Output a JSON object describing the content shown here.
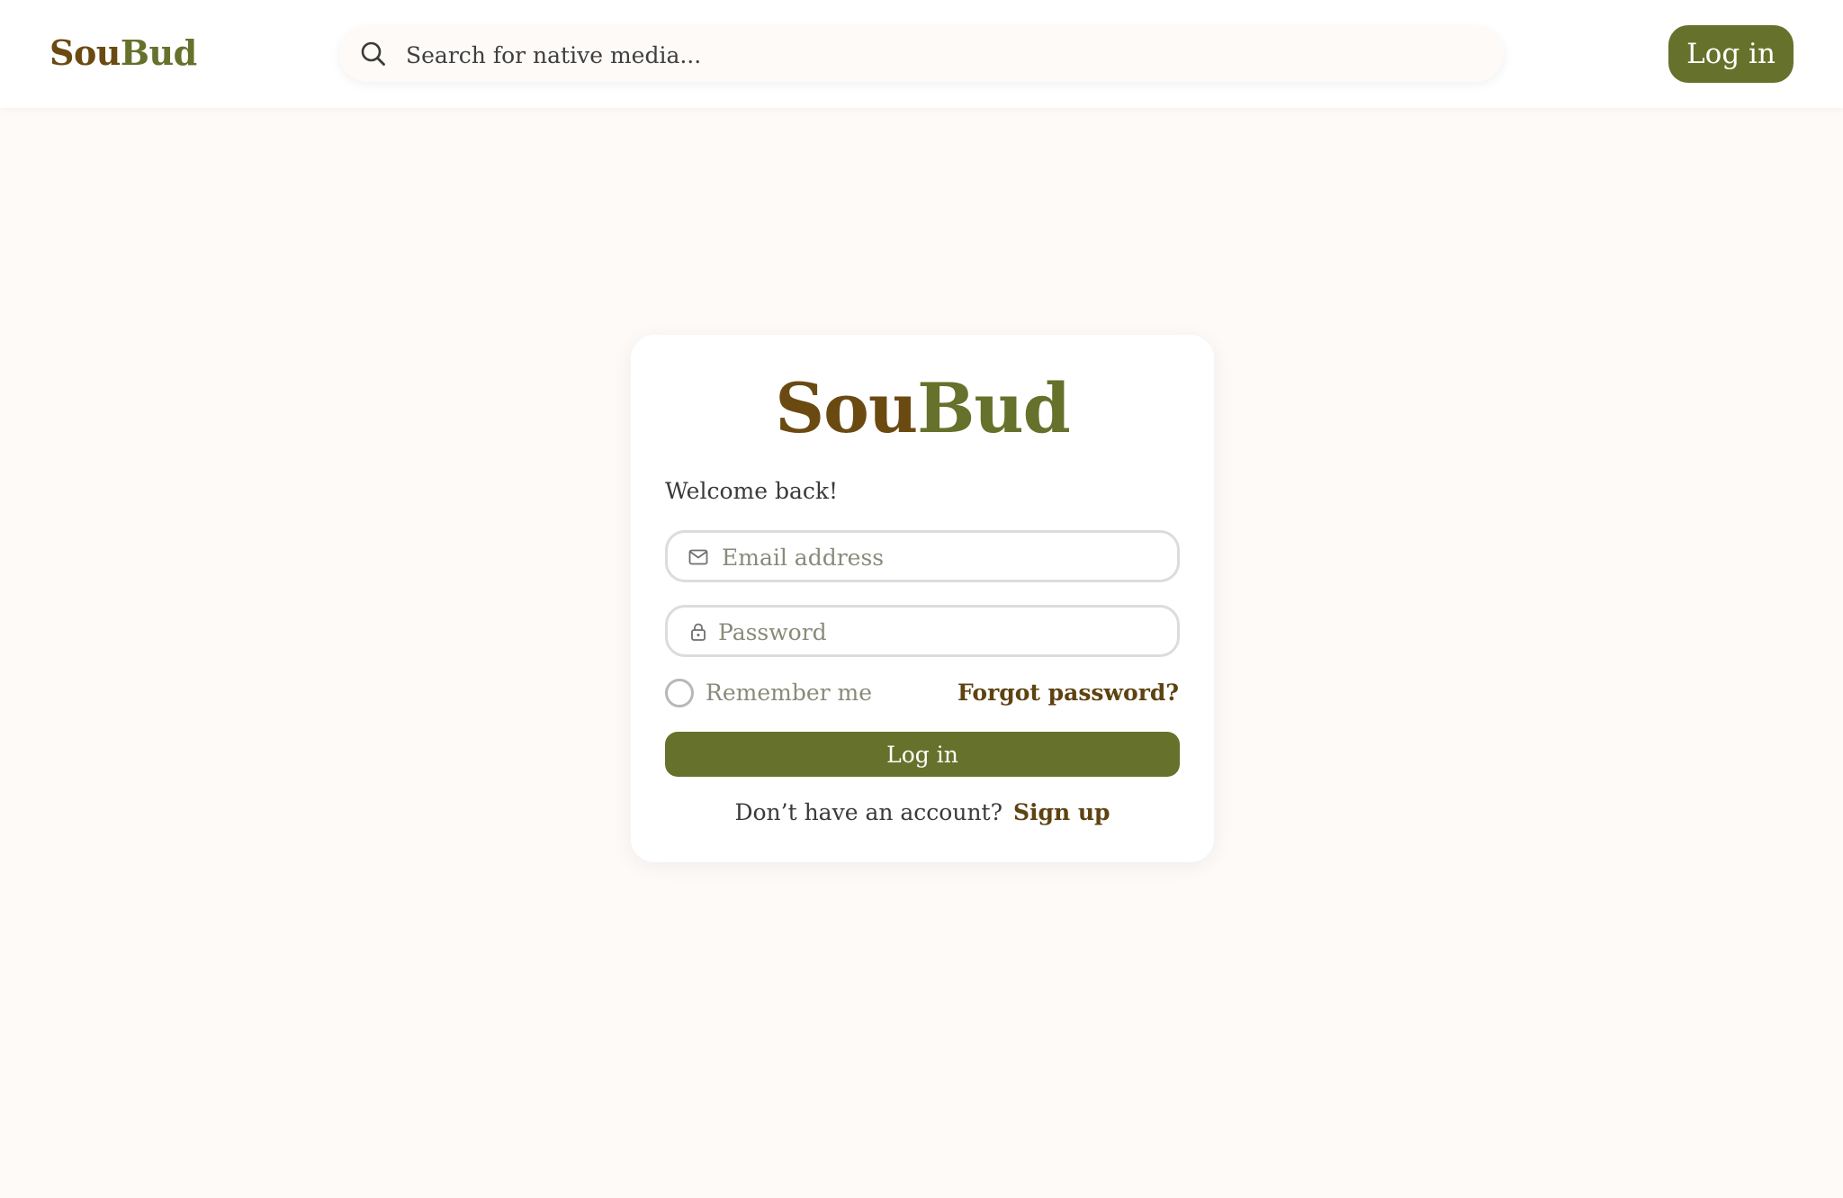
{
  "brand": {
    "part1": "Sou",
    "part2": "Bud",
    "part1_color": "#6b4a12",
    "part2_color": "#66712b"
  },
  "header": {
    "search_placeholder": "Search for native media...",
    "login_label": "Log in",
    "search_icon": "search-icon"
  },
  "login_card": {
    "welcome": "Welcome back!",
    "email_placeholder": "Email address",
    "email_icon": "mail-icon",
    "password_placeholder": "Password",
    "password_icon": "lock-icon",
    "remember_label": "Remember me",
    "forgot_label": "Forgot password?",
    "login_label": "Log in",
    "signup_prompt": "Don’t have an account?",
    "signup_label": "Sign up"
  },
  "colors": {
    "accent": "#66712b",
    "brown": "#5e4210",
    "background": "#fdfaf8"
  }
}
